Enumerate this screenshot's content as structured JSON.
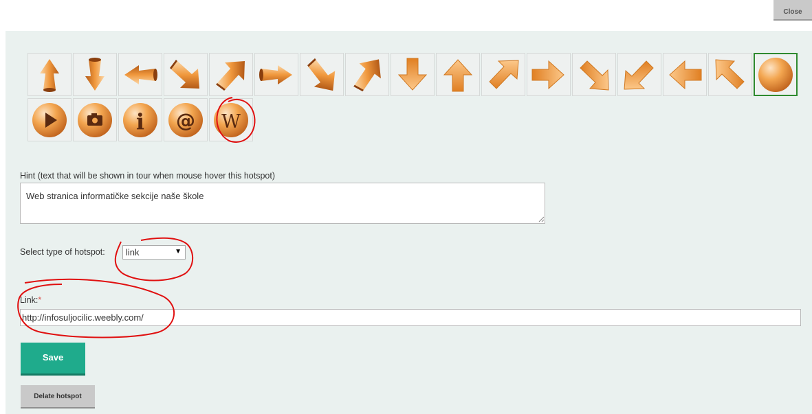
{
  "close_label": "Close",
  "icon_grid": {
    "selected_icon": "sphere-icon",
    "row1_icons": [
      "arrow-up-icon",
      "arrow-down-icon",
      "arrow-left-icon",
      "arrow-down-right-icon",
      "arrow-up-right-icon",
      "arrow-right-icon",
      "arrow-down-right-icon",
      "arrow-up-right-icon",
      "flat-arrow-down-icon",
      "flat-arrow-up-icon",
      "flat-arrow-up-right-icon",
      "flat-arrow-right-icon",
      "flat-arrow-down-right-icon",
      "flat-arrow-down-left-icon",
      "flat-arrow-left-icon",
      "flat-arrow-up-left-icon",
      "sphere-icon"
    ],
    "row2_icons": [
      "play-icon",
      "camera-icon",
      "info-icon",
      "email-at-icon",
      "wikipedia-icon"
    ],
    "glyphs": {
      "info": "i",
      "at": "@",
      "wiki": "W"
    },
    "accent_color": "#e8902e",
    "selected_border_color": "#2f8a2f"
  },
  "hint": {
    "label": "Hint (text that will be shown in tour when mouse hover this hotspot)",
    "value": "Web stranica informatičke sekcije naše škole"
  },
  "hotspot_type": {
    "label": "Select type of hotspot:",
    "selected": "link"
  },
  "link": {
    "label": "Link:",
    "required_marker": "*",
    "value": "http://infosuljocilic.weebly.com/"
  },
  "save_label": "Save",
  "delete_label": "Delate hotspot",
  "colors": {
    "panel_bg": "#eaf1ef",
    "save_button": "#1fab8c",
    "required": "#d9534f",
    "annotation": "#e01010"
  }
}
